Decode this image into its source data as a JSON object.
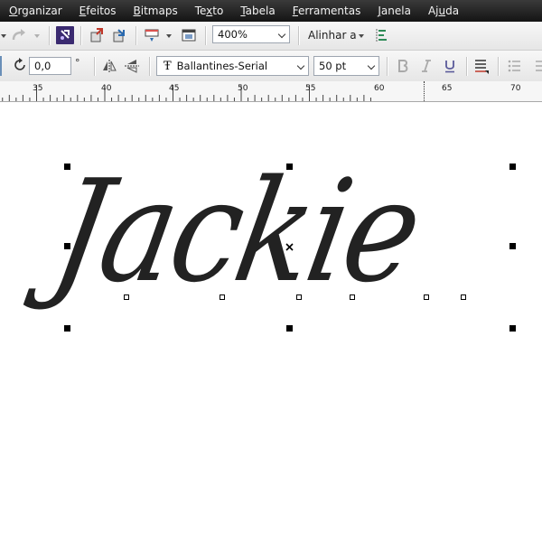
{
  "menubar": {
    "items": [
      {
        "underline": "O",
        "rest": "rganizar"
      },
      {
        "underline": "E",
        "rest": "feitos"
      },
      {
        "underline": "B",
        "rest": "itmaps"
      },
      {
        "pre": "Te",
        "underline": "x",
        "rest": "to"
      },
      {
        "underline": "T",
        "rest": "abela"
      },
      {
        "underline": "F",
        "rest": "erramentas"
      },
      {
        "underline": "J",
        "rest": "anela"
      },
      {
        "pre": "Aj",
        "underline": "u",
        "rest": "da"
      }
    ]
  },
  "toolbar1": {
    "zoom_value": "400%",
    "align_label": "Alinhar a"
  },
  "toolbar2": {
    "rotation_value": "0,0",
    "rotation_unit": "°",
    "font_name": "Ballantines-Serial",
    "font_icon": "Ŧ",
    "font_size": "50 pt"
  },
  "ruler": {
    "labels": [
      "35",
      "40",
      "45",
      "50",
      "55",
      "60",
      "65",
      "70"
    ]
  },
  "canvas": {
    "artwork_text": "Jackie"
  },
  "colors": {
    "menubar_bg": "#1f1f1f",
    "toolbar_bg": "#eeeeee",
    "artwork": "#222222"
  },
  "icons": {
    "undo": "undo-icon",
    "redo": "redo-icon",
    "rotate": "rotate-icon",
    "bold": "bold-icon",
    "italic": "italic-icon",
    "underline": "underline-icon"
  }
}
